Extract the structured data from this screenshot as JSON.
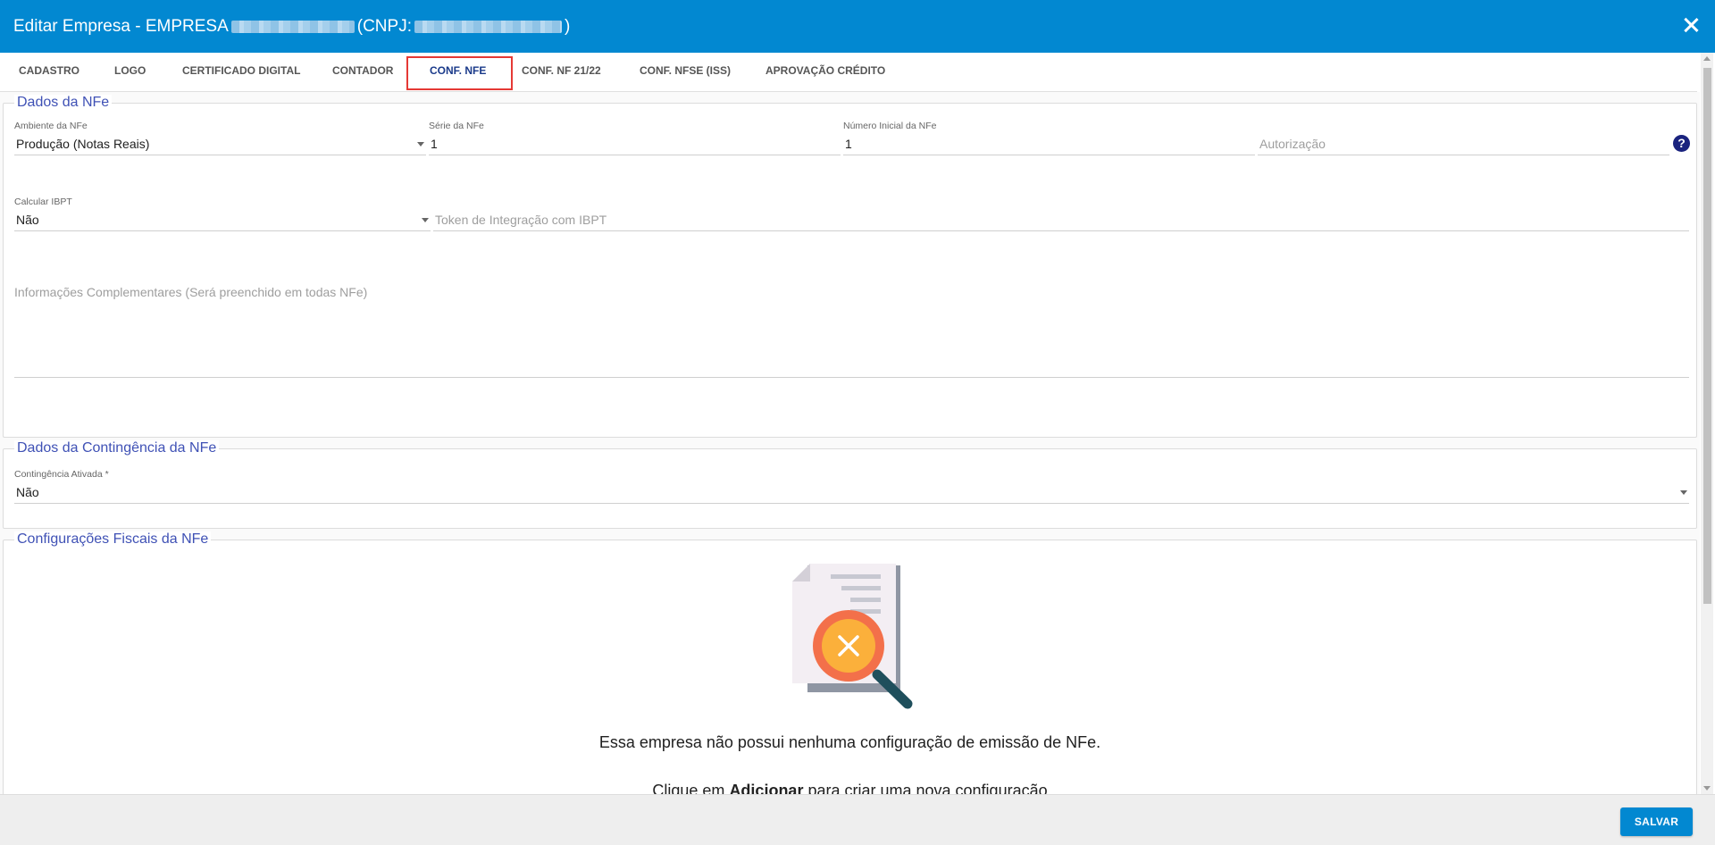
{
  "window": {
    "title_prefix": "Editar Empresa - EMPRESA",
    "cnpj_label": "(CNPJ:",
    "cnpj_close": ")",
    "close_icon": "close-icon"
  },
  "tabs": [
    {
      "label": "CADASTRO"
    },
    {
      "label": "LOGO"
    },
    {
      "label": "CERTIFICADO DIGITAL"
    },
    {
      "label": "CONTADOR"
    },
    {
      "label": "CONF. NFE"
    },
    {
      "label": "CONF. NF 21/22"
    },
    {
      "label": "CONF. NFSE (ISS)"
    },
    {
      "label": "APROVAÇÃO CRÉDITO"
    }
  ],
  "active_tab": "CONF. NFE",
  "dados_nfe": {
    "legend": "Dados da NFe",
    "ambiente_label": "Ambiente da NFe",
    "ambiente_value": "Produção (Notas Reais)",
    "serie_label": "Série da NFe",
    "serie_value": "1",
    "numero_label": "Número Inicial da NFe",
    "numero_value": "1",
    "autorizacao_placeholder": "Autorização",
    "help": "?",
    "ibpt_label": "Calcular IBPT",
    "ibpt_value": "Não",
    "token_placeholder": "Token de Integração com IBPT",
    "info_placeholder": "Informações Complementares (Será preenchido em todas NFe)"
  },
  "contingencia": {
    "legend": "Dados da Contingência da NFe",
    "ativada_label": "Contingência Ativada *",
    "ativada_value": "Não"
  },
  "fiscais": {
    "legend": "Configurações Fiscais da NFe",
    "empty_message": "Essa empresa não possui nenhuma configuração de emissão de NFe.",
    "hint_prefix": "Clique em ",
    "hint_bold": "Adicionar",
    "hint_suffix": " para criar uma nova configuração"
  },
  "footer": {
    "save_label": "SALVAR"
  },
  "colors": {
    "header": "#0288d1",
    "legend": "#3f51b5",
    "highlight": "#e53935"
  }
}
